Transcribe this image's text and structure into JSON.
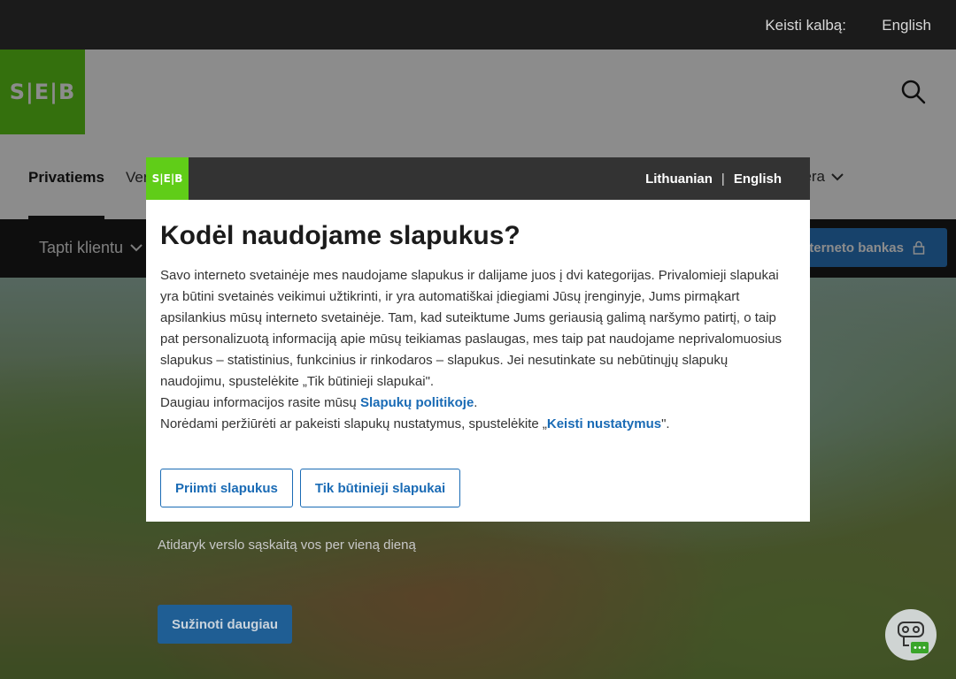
{
  "topbar": {
    "lang_label": "Keisti kalbą:",
    "lang_link": "English"
  },
  "header": {
    "logo_text": "S|E|B",
    "nav": [
      {
        "label": "Privatiems"
      },
      {
        "label": "Vers"
      }
    ],
    "nav_right_label": "rjera"
  },
  "subnav": {
    "item_label": "Tapti klientu",
    "bank_button": "nterneto bankas"
  },
  "hero": {
    "subtitle": "Atidaryk verslo sąskaitą vos per vieną dieną",
    "button": "Sužinoti daugiau"
  },
  "dialog": {
    "logo_text": "S|E|B",
    "lang_lt": "Lithuanian",
    "lang_sep": "|",
    "lang_en": "English",
    "title": "Kodėl naudojame slapukus?",
    "paragraph": "Savo interneto svetainėje mes naudojame slapukus ir dalijame juos į dvi kategorijas. Privalomieji slapukai yra būtini svetainės veikimui užtikrinti, ir yra automatiškai įdiegiami Jūsų įrenginyje, Jums pirmąkart apsilankius mūsų interneto svetainėje. Tam, kad suteiktume Jums geriausią galimą naršymo patirtį, o taip pat personalizuotą informaciją apie mūsų teikiamas paslaugas, mes taip pat naudojame neprivalomuosius slapukus – statistinius, funkcinius ir rinkodaros – slapukus. Jei nesutinkate su nebūtinųjų slapukų naudojimu, spustelėkite „Tik būtinieji slapukai\".",
    "more_info_prefix": "Daugiau informacijos rasite mūsų ",
    "policy_link": "Slapukų politikoje",
    "more_info_suffix": ".",
    "settings_prefix": "Norėdami peržiūrėti ar pakeisti slapukų nustatymus, spustelėkite „",
    "settings_link": "Keisti nustatymus",
    "settings_suffix": "\".",
    "accept_button": "Priimti slapukus",
    "necessary_button": "Tik būtinieji slapukai"
  }
}
